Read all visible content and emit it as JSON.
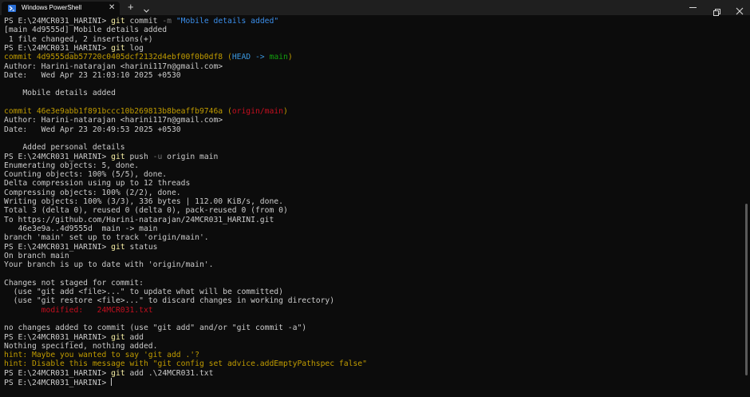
{
  "window": {
    "tab_title": "Windows PowerShell",
    "tab_close": "✕",
    "new_tab": "+",
    "icons": [
      "powershell-icon",
      "close-icon",
      "plus-icon",
      "chevron-down-icon",
      "minimize-icon",
      "maximize-icon",
      "close-icon"
    ]
  },
  "colors": {
    "background": "#0c0c0c",
    "text": "#cccccc",
    "command": "#f9f1a5",
    "string": "#3b8eea",
    "commit_hash": "#c19c00",
    "head_ref": "#3a96dd",
    "branch": "#13a10e",
    "remote_ref": "#c50f1f",
    "hint": "#c19c00"
  },
  "terminal": {
    "lines": [
      [
        {
          "t": "PS E:\\24MCR031_HARINI> "
        },
        {
          "t": "git",
          "c": "kw"
        },
        {
          "t": " commit "
        },
        {
          "t": "-m",
          "c": "flag"
        },
        {
          "t": " "
        },
        {
          "t": "\"Mobile details added\"",
          "c": "str"
        }
      ],
      [
        {
          "t": "[main 4d9555d] Mobile details added"
        }
      ],
      [
        {
          "t": " 1 file changed, 2 insertions(+)"
        }
      ],
      [
        {
          "t": "PS E:\\24MCR031_HARINI> "
        },
        {
          "t": "git",
          "c": "kw"
        },
        {
          "t": " log"
        }
      ],
      [
        {
          "t": "commit 4d9555dab57720c0405dcf2132d4ebf00f0b0df8 ",
          "c": "yel"
        },
        {
          "t": "(",
          "c": "yel"
        },
        {
          "t": "HEAD -> ",
          "c": "cyn"
        },
        {
          "t": "main",
          "c": "grn"
        },
        {
          "t": ")",
          "c": "yel"
        }
      ],
      [
        {
          "t": "Author: Harini-natarajan <harini117n@gmail.com>"
        }
      ],
      [
        {
          "t": "Date:   Wed Apr 23 21:03:10 2025 +0530"
        }
      ],
      [
        {
          "t": ""
        }
      ],
      [
        {
          "t": "    Mobile details added"
        }
      ],
      [
        {
          "t": ""
        }
      ],
      [
        {
          "t": "commit 46e3e9abb1f891bccc10b269813b8beaffb9746a ",
          "c": "yel"
        },
        {
          "t": "(",
          "c": "yel"
        },
        {
          "t": "origin/main",
          "c": "red"
        },
        {
          "t": ")",
          "c": "yel"
        }
      ],
      [
        {
          "t": "Author: Harini-natarajan <harini117n@gmail.com>"
        }
      ],
      [
        {
          "t": "Date:   Wed Apr 23 20:49:53 2025 +0530"
        }
      ],
      [
        {
          "t": ""
        }
      ],
      [
        {
          "t": "    Added personal details"
        }
      ],
      [
        {
          "t": "PS E:\\24MCR031_HARINI> "
        },
        {
          "t": "git",
          "c": "kw"
        },
        {
          "t": " push "
        },
        {
          "t": "-u",
          "c": "flag"
        },
        {
          "t": " origin main"
        }
      ],
      [
        {
          "t": "Enumerating objects: 5, done."
        }
      ],
      [
        {
          "t": "Counting objects: 100% (5/5), done."
        }
      ],
      [
        {
          "t": "Delta compression using up to 12 threads"
        }
      ],
      [
        {
          "t": "Compressing objects: 100% (2/2), done."
        }
      ],
      [
        {
          "t": "Writing objects: 100% (3/3), 336 bytes | 112.00 KiB/s, done."
        }
      ],
      [
        {
          "t": "Total 3 (delta 0), reused 0 (delta 0), pack-reused 0 (from 0)"
        }
      ],
      [
        {
          "t": "To https://github.com/Harini-natarajan/24MCR031_HARINI.git"
        }
      ],
      [
        {
          "t": "   46e3e9a..4d9555d  main -> main"
        }
      ],
      [
        {
          "t": "branch 'main' set up to track 'origin/main'."
        }
      ],
      [
        {
          "t": "PS E:\\24MCR031_HARINI> "
        },
        {
          "t": "git",
          "c": "kw"
        },
        {
          "t": " status"
        }
      ],
      [
        {
          "t": "On branch main"
        }
      ],
      [
        {
          "t": "Your branch is up to date with 'origin/main'."
        }
      ],
      [
        {
          "t": ""
        }
      ],
      [
        {
          "t": "Changes not staged for commit:"
        }
      ],
      [
        {
          "t": "  (use \"git add <file>...\" to update what will be committed)"
        }
      ],
      [
        {
          "t": "  (use \"git restore <file>...\" to discard changes in working directory)"
        }
      ],
      [
        {
          "t": "        modified:   24MCR031.txt",
          "c": "red"
        }
      ],
      [
        {
          "t": ""
        }
      ],
      [
        {
          "t": "no changes added to commit (use \"git add\" and/or \"git commit -a\")"
        }
      ],
      [
        {
          "t": "PS E:\\24MCR031_HARINI> "
        },
        {
          "t": "git",
          "c": "kw"
        },
        {
          "t": " add"
        }
      ],
      [
        {
          "t": "Nothing specified, nothing added."
        }
      ],
      [
        {
          "t": "hint: Maybe you wanted to say 'git add .'?",
          "c": "hint"
        }
      ],
      [
        {
          "t": "hint: Disable this message with \"git config set advice.addEmptyPathspec false\"",
          "c": "hint"
        }
      ],
      [
        {
          "t": "PS E:\\24MCR031_HARINI> "
        },
        {
          "t": "git",
          "c": "kw"
        },
        {
          "t": " add .\\24MCR031.txt"
        }
      ],
      [
        {
          "t": "PS E:\\24MCR031_HARINI> "
        }
      ]
    ]
  }
}
